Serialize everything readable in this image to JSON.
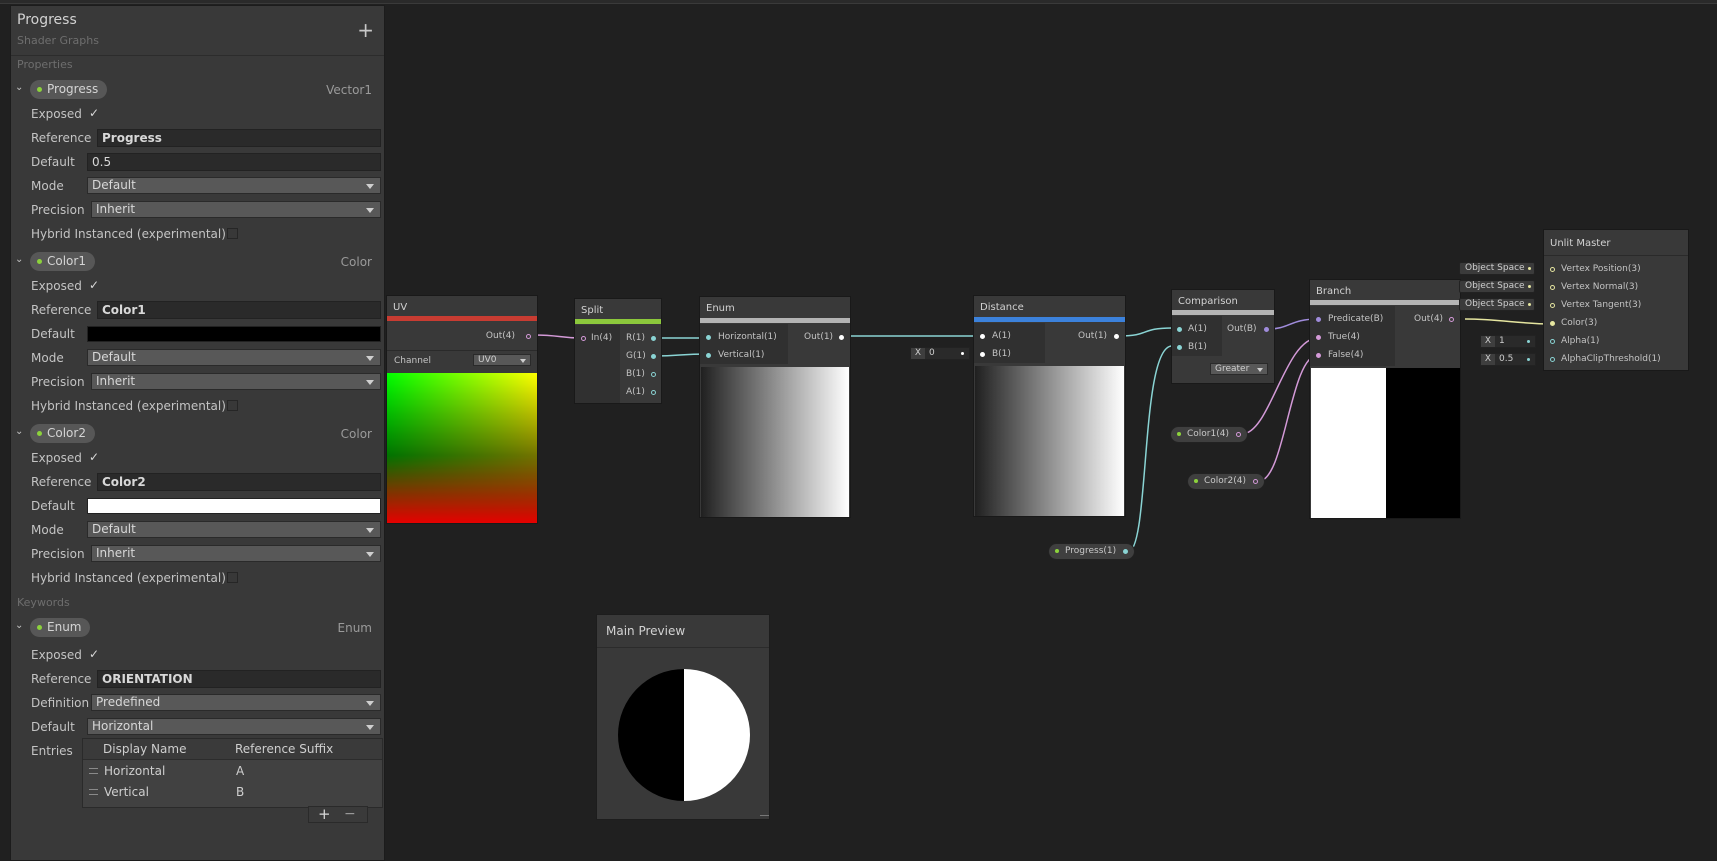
{
  "blackboard": {
    "title": "Progress",
    "subtitle": "Shader Graphs",
    "add_label": "+",
    "sections": {
      "properties": "Properties",
      "keywords": "Keywords"
    },
    "labels": {
      "exposed": "Exposed",
      "reference": "Reference",
      "default": "Default",
      "mode": "Mode",
      "precision": "Precision",
      "hybrid": "Hybrid Instanced (experimental)",
      "definition": "Definition",
      "entries": "Entries",
      "check": "✓"
    },
    "progress": {
      "name": "Progress",
      "type": "Vector1",
      "reference": "Progress",
      "default": "0.5",
      "mode": "Default",
      "precision": "Inherit"
    },
    "color1": {
      "name": "Color1",
      "type": "Color",
      "reference": "Color1",
      "default_color": "#000000",
      "mode": "Default",
      "precision": "Inherit"
    },
    "color2": {
      "name": "Color2",
      "type": "Color",
      "reference": "Color2",
      "default_color": "#ffffff",
      "mode": "Default",
      "precision": "Inherit"
    },
    "enum": {
      "name": "Enum",
      "type": "Enum",
      "reference": "ORIENTATION",
      "definition": "Predefined",
      "default": "Horizontal",
      "entries_header": {
        "display_name": "Display Name",
        "reference_suffix": "Reference Suffix"
      },
      "entries": [
        {
          "display_name": "Horizontal",
          "suffix": "A"
        },
        {
          "display_name": "Vertical",
          "suffix": "B"
        }
      ],
      "add_label": "+",
      "remove_label": "−"
    }
  },
  "nodes": {
    "uv": {
      "title": "UV",
      "out": "Out(4)",
      "channel_label": "Channel",
      "channel": "UV0",
      "color": "#c83c32"
    },
    "split": {
      "title": "Split",
      "in": "In(4)",
      "outs": [
        "R(1)",
        "G(1)",
        "B(1)",
        "A(1)"
      ],
      "color": "#8cc83c"
    },
    "enum": {
      "title": "Enum",
      "ins": [
        "Horizontal(1)",
        "Vertical(1)"
      ],
      "out": "Out(1)",
      "color": "#b4b4b4"
    },
    "distance": {
      "title": "Distance",
      "ins": [
        "A(1)",
        "B(1)"
      ],
      "out": "Out(1)",
      "b_value_x": "X",
      "b_value": "0",
      "color": "#3c82dc"
    },
    "comparison": {
      "title": "Comparison",
      "ins": [
        "A(1)",
        "B(1)"
      ],
      "out": "Out(B)",
      "operation": "Greater",
      "color": "#b4b4b4"
    },
    "branch": {
      "title": "Branch",
      "ins": [
        "Predicate(B)",
        "True(4)",
        "False(4)"
      ],
      "out": "Out(4)",
      "color": "#b4b4b4"
    },
    "master": {
      "title": "Unlit Master",
      "ports": [
        "Vertex Position(3)",
        "Vertex Normal(3)",
        "Vertex Tangent(3)",
        "Color(3)",
        "Alpha(1)",
        "AlphaClipThreshold(1)"
      ],
      "space_slots": [
        "Object Space",
        "Object Space",
        "Object Space"
      ],
      "alpha": {
        "x": "X",
        "value": "1"
      },
      "clip": {
        "x": "X",
        "value": "0.5"
      }
    },
    "prop_color1": "Color1(4)",
    "prop_color2": "Color2(4)",
    "prop_progress": "Progress(1)"
  },
  "main_preview": {
    "title": "Main Preview"
  }
}
